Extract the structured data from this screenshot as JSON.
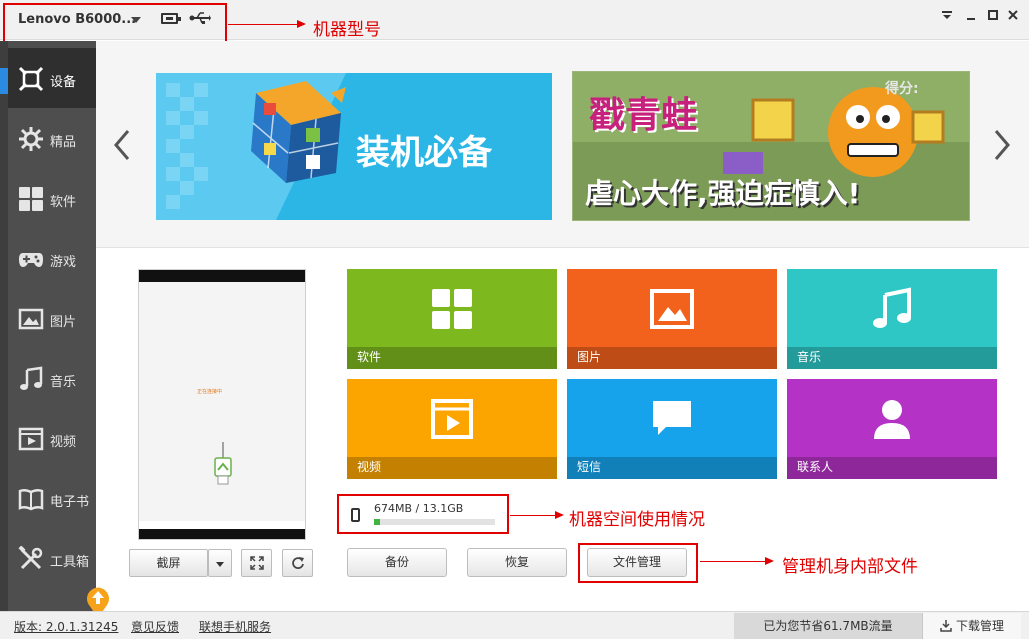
{
  "titlebar": {
    "device_name": "Lenovo B6000...",
    "annotation_device": "机器型号"
  },
  "sidebar": {
    "items": [
      {
        "label": "设备",
        "icon": "device-icon"
      },
      {
        "label": "精品",
        "icon": "gear-star-icon"
      },
      {
        "label": "软件",
        "icon": "apps-grid-icon"
      },
      {
        "label": "游戏",
        "icon": "gamepad-icon"
      },
      {
        "label": "图片",
        "icon": "image-icon"
      },
      {
        "label": "音乐",
        "icon": "music-note-icon"
      },
      {
        "label": "视频",
        "icon": "video-icon"
      },
      {
        "label": "电子书",
        "icon": "book-icon"
      },
      {
        "label": "工具箱",
        "icon": "tools-icon"
      }
    ]
  },
  "banners": [
    {
      "title": "装机必备"
    },
    {
      "title": "戳青蛙",
      "subtitle": "虐心大作,强迫症慎入!",
      "score_label": "得分:"
    }
  ],
  "phone_preview": {
    "center_text": "正在连接中"
  },
  "screenshot_controls": {
    "screenshot_label": "截屏"
  },
  "tiles": [
    {
      "label": "软件",
      "color": "#7eb81f",
      "icon": "apps-grid-icon"
    },
    {
      "label": "图片",
      "color": "#f2621d",
      "icon": "image-icon"
    },
    {
      "label": "音乐",
      "color": "#2ec7c6",
      "icon": "music-note-icon"
    },
    {
      "label": "视频",
      "color": "#fca500",
      "icon": "video-icon"
    },
    {
      "label": "短信",
      "color": "#17a3ec",
      "icon": "chat-bubble-icon"
    },
    {
      "label": "联系人",
      "color": "#b532c6",
      "icon": "person-icon"
    }
  ],
  "storage": {
    "text": "674MB / 13.1GB",
    "used_fraction": 0.05,
    "annotation": "机器空间使用情况"
  },
  "actions": {
    "backup": "备份",
    "restore": "恢复",
    "file_manager": "文件管理",
    "annotation": "管理机身内部文件"
  },
  "footer": {
    "version": "版本: 2.0.1.31245",
    "feedback": "意见反馈",
    "service": "联想手机服务",
    "saved": "已为您节省61.7MB流量",
    "download_manager": "下载管理"
  }
}
